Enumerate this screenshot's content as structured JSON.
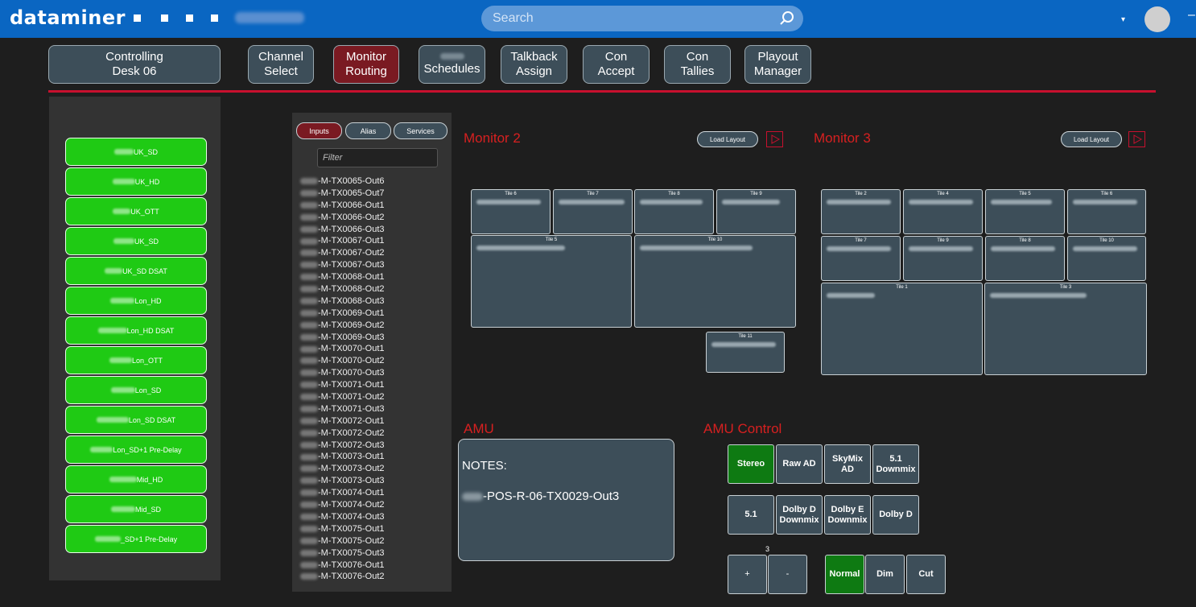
{
  "app": {
    "brand": "dataminer",
    "search_placeholder": "Search"
  },
  "nav": [
    {
      "line1": "Controlling",
      "line2": "Desk 06",
      "active": false
    },
    {
      "line1": "Channel",
      "line2": "Select",
      "active": false
    },
    {
      "line1": "Monitor",
      "line2": "Routing",
      "active": true
    },
    {
      "line1": "",
      "line2": "Schedules",
      "active": false
    },
    {
      "line1": "Talkback",
      "line2": "Assign",
      "active": false
    },
    {
      "line1": "Con",
      "line2": "Accept",
      "active": false
    },
    {
      "line1": "Con",
      "line2": "Tallies",
      "active": false
    },
    {
      "line1": "Playout",
      "line2": "Manager",
      "active": false
    }
  ],
  "channels": [
    "UK_SD",
    "UK_HD",
    "UK_OTT",
    "UK_SD",
    "UK_SD DSAT",
    "Lon_HD",
    "Lon_HD DSAT",
    "Lon_OTT",
    "Lon_SD",
    "Lon_SD DSAT",
    "Lon_SD+1 Pre-Delay",
    "Mid_HD",
    "Mid_SD",
    "_SD+1 Pre-Delay"
  ],
  "source_tabs": [
    {
      "label": "Inputs",
      "active": true
    },
    {
      "label": "Alias",
      "active": false
    },
    {
      "label": "Services",
      "active": false
    }
  ],
  "filter_placeholder": "Filter",
  "sources": [
    "-M-TX0065-Out6",
    "-M-TX0065-Out7",
    "-M-TX0066-Out1",
    "-M-TX0066-Out2",
    "-M-TX0066-Out3",
    "-M-TX0067-Out1",
    "-M-TX0067-Out2",
    "-M-TX0067-Out3",
    "-M-TX0068-Out1",
    "-M-TX0068-Out2",
    "-M-TX0068-Out3",
    "-M-TX0069-Out1",
    "-M-TX0069-Out2",
    "-M-TX0069-Out3",
    "-M-TX0070-Out1",
    "-M-TX0070-Out2",
    "-M-TX0070-Out3",
    "-M-TX0071-Out1",
    "-M-TX0071-Out2",
    "-M-TX0071-Out3",
    "-M-TX0072-Out1",
    "-M-TX0072-Out2",
    "-M-TX0072-Out3",
    "-M-TX0073-Out1",
    "-M-TX0073-Out2",
    "-M-TX0073-Out3",
    "-M-TX0074-Out1",
    "-M-TX0074-Out2",
    "-M-TX0074-Out3",
    "-M-TX0075-Out1",
    "-M-TX0075-Out2",
    "-M-TX0075-Out3",
    "-M-TX0076-Out1",
    "-M-TX0076-Out2"
  ],
  "monitor2": {
    "title": "Monitor 2",
    "load_layout": "Load Layout",
    "tiles": [
      "Tile 6",
      "Tile 7",
      "Tile 8",
      "Tile 9",
      "Tile 5",
      "Tile 10",
      "Tile 11"
    ]
  },
  "monitor3": {
    "title": "Monitor 3",
    "load_layout": "Load Layout",
    "tiles": [
      "Tile 2",
      "Tile 4",
      "Tile 5",
      "Tile 6",
      "Tile 7",
      "Tile 9",
      "Tile 8",
      "Tile 10",
      "Tile 1",
      "Tile 3"
    ]
  },
  "amu": {
    "title": "AMU",
    "notes_label": "NOTES:",
    "source": "-POS-R-06-TX0029-Out3"
  },
  "amu_control": {
    "title": "AMU Control",
    "mode_buttons": [
      {
        "label": "Stereo",
        "on": true
      },
      {
        "label": "Raw AD",
        "on": false
      },
      {
        "label": "SkyMix AD",
        "on": false
      },
      {
        "label": "5.1 Downmix",
        "on": false
      },
      {
        "label": "5.1",
        "on": false
      },
      {
        "label": "Dolby D Downmix",
        "on": false
      },
      {
        "label": "Dolby E Downmix",
        "on": false
      },
      {
        "label": "Dolby D",
        "on": false
      }
    ],
    "volume_value": "3",
    "plus": "+",
    "minus": "-",
    "level_buttons": [
      {
        "label": "Normal",
        "on": true
      },
      {
        "label": "Dim",
        "on": false
      },
      {
        "label": "Cut",
        "on": false
      }
    ]
  },
  "colors": {
    "topbar": "#0a66c2",
    "accent_red": "#c8102e",
    "channel_green": "#1fca14",
    "active_green": "#0e7a12",
    "panel_slate": "#3d4e59",
    "active_maroon": "#7a1a22"
  }
}
